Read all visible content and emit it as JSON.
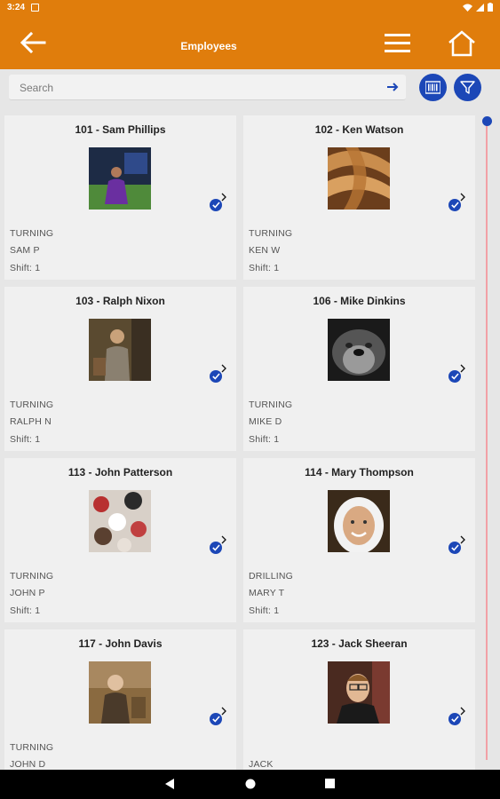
{
  "status": {
    "time": "3:24"
  },
  "appbar": {
    "title": "Employees"
  },
  "search": {
    "placeholder": "Search"
  },
  "employees": [
    {
      "name": "101 - Sam Phillips",
      "department": "TURNING",
      "short": "SAM P",
      "shift": "Shift:  1"
    },
    {
      "name": "102 - Ken Watson",
      "department": "TURNING",
      "short": "KEN W",
      "shift": "Shift:  1"
    },
    {
      "name": "103 - Ralph Nixon",
      "department": "TURNING",
      "short": "RALPH N",
      "shift": "Shift:  1"
    },
    {
      "name": "106 - Mike Dinkins",
      "department": "TURNING",
      "short": "MIKE D",
      "shift": "Shift:  1"
    },
    {
      "name": "113 - John Patterson",
      "department": "TURNING",
      "short": "JOHN P",
      "shift": "Shift:  1"
    },
    {
      "name": "114 - Mary Thompson",
      "department": "DRILLING",
      "short": "MARY T",
      "shift": "Shift:  1"
    },
    {
      "name": "117 - John Davis",
      "department": "TURNING",
      "short": "JOHN D",
      "shift": ""
    },
    {
      "name": "123 - Jack Sheeran",
      "department": "",
      "short": "JACK",
      "shift": ""
    }
  ],
  "colors": {
    "appbar": "#e07d0c",
    "accent": "#1c47b7",
    "card": "#f0f0f0",
    "scroll_track": "#f2a0a6"
  },
  "icons": [
    "back-arrow-icon",
    "hamburger-menu-icon",
    "home-icon",
    "arrow-right-icon",
    "barcode-icon",
    "filter-icon",
    "check-icon"
  ]
}
